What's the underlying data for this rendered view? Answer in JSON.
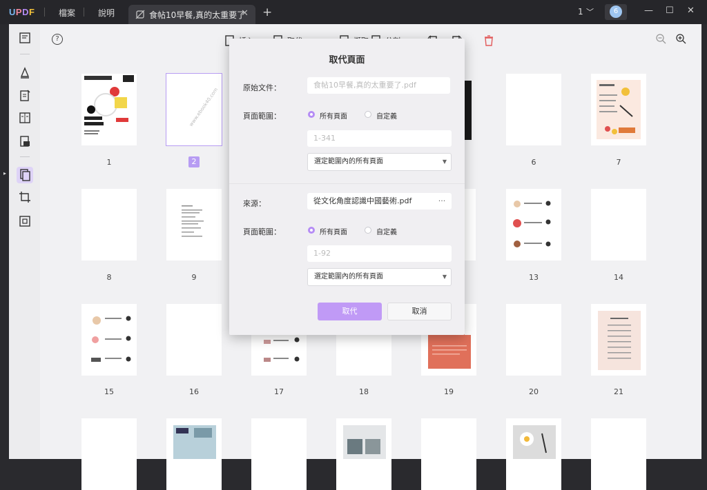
{
  "app": {
    "logo": {
      "u": "U",
      "p": "P",
      "d": "D",
      "f": "F"
    },
    "menu": [
      "檔案",
      "說明"
    ],
    "tab_title": "食帖10早餐,真的太重要了",
    "current_page": "1",
    "avatar_letter": "6"
  },
  "toolbar": {
    "help": "?",
    "labels": [
      "插入",
      "取代",
      "擷取",
      "分割"
    ]
  },
  "pages": {
    "row1_visible": [
      "1",
      "2",
      "6",
      "7"
    ],
    "row2": [
      "8",
      "9",
      "13",
      "14"
    ],
    "row3": [
      "15",
      "16",
      "17",
      "18",
      "19",
      "20",
      "21"
    ],
    "selected": "2"
  },
  "dialog": {
    "title": "取代頁面",
    "orig_label": "原始文件：",
    "orig_value": "食帖10早餐,真的太重要了.pdf",
    "range_label": "頁面範圍：",
    "radio_all": "所有頁面",
    "radio_custom": "自定義",
    "range1_placeholder": "1-341",
    "select_value": "選定範圍內的所有頁面",
    "source_label": "來源：",
    "source_value": "從文化角度認識中國藝術.pdf",
    "more": "···",
    "range2_placeholder": "1-92",
    "replace_btn": "取代",
    "cancel_btn": "取消"
  },
  "colors": {
    "accent": "#c09af6",
    "selection": "#b79cf3"
  }
}
